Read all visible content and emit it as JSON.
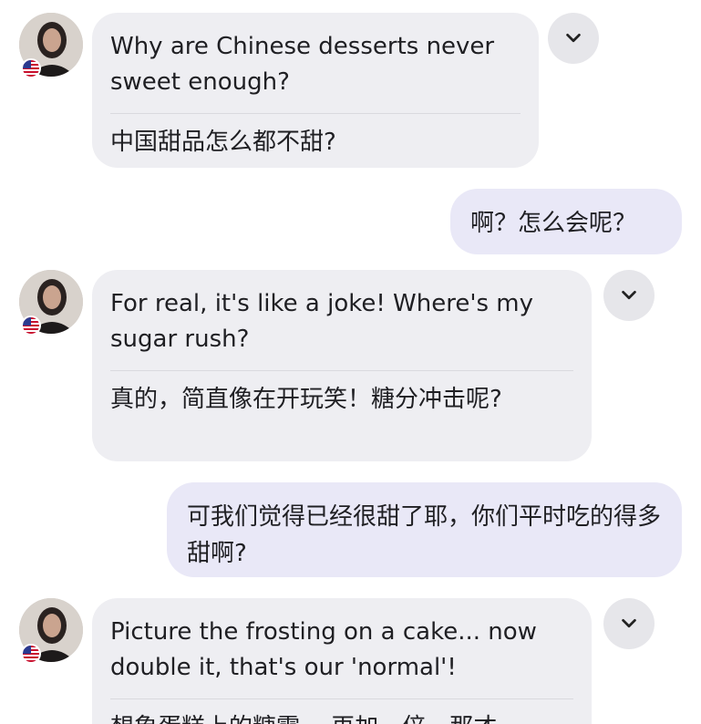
{
  "messages": [
    {
      "direction": "incoming",
      "original": "Why are Chinese desserts never sweet enough?",
      "translation": "中国甜品怎么都不甜?"
    },
    {
      "direction": "outgoing",
      "text": "啊？怎么会呢？"
    },
    {
      "direction": "incoming",
      "original": "For real, it's like a joke! Where's my sugar rush?",
      "translation": "真的，简直像在开玩笑！糖分冲击呢?"
    },
    {
      "direction": "outgoing",
      "text": "可我们觉得已经很甜了耶，你们平时吃的得多甜啊?"
    },
    {
      "direction": "incoming",
      "original": "Picture the frosting on a cake... now double it, that's our 'normal'!",
      "translation": "想象蛋糕上的糖霜… 再加一倍，那才"
    }
  ],
  "icons": {
    "avatar": "avatar",
    "flag": "us-flag-icon",
    "menu": "chevron-down-icon"
  },
  "colors": {
    "incoming_bubble": "#eeeef2",
    "outgoing_bubble": "#e9e8f7",
    "text": "#1f1f23"
  }
}
